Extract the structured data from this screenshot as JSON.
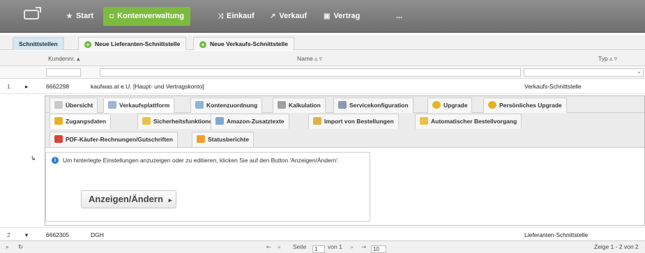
{
  "nav": {
    "items": [
      {
        "label": "Start",
        "icon": "star-icon"
      },
      {
        "label": "Kontenverwaltung",
        "icon": "accounts-icon"
      },
      {
        "label": "Einkauf",
        "icon": "shuffle-icon"
      },
      {
        "label": "Verkauf",
        "icon": "share-icon"
      },
      {
        "label": "Vertrag",
        "icon": "contract-icon"
      },
      {
        "label": "...",
        "icon": ""
      }
    ]
  },
  "tabs": {
    "interfaces": "Schnittstellen",
    "new_supplier": "Neue Lieferanten-Schnittstelle",
    "new_sales": "Neue Verkaufs-Schnittstelle"
  },
  "grid": {
    "columns": {
      "customer_no": "Kundennr. ▴",
      "name": "Name ▵ ▿",
      "type": "Typ ▵ ▿"
    },
    "rows": [
      {
        "index": "1",
        "toggle": "▸",
        "customer_no": "6662298",
        "name": "kaufwas.at e.U. [Haupt- und Vertragskonto]",
        "type": "Verkaufs-Schnittstelle"
      },
      {
        "index": "2",
        "toggle": "▾",
        "customer_no": "6662305",
        "name": "DGH",
        "type": "Lieferanten-Schnittstelle"
      }
    ],
    "sub_marker": "↳"
  },
  "panel": {
    "tabs1": [
      {
        "label": "Übersicht",
        "color": "#c9c9c9"
      },
      {
        "label": "Verkaufsplattform",
        "color": "#9bb5d4"
      },
      {
        "label": "Kontenzuordnung",
        "color": "#8fb3d9"
      },
      {
        "label": "Kalkulation",
        "color": "#a0a0a0"
      },
      {
        "label": "Servicekonfiguration",
        "color": "#8c9ab0"
      },
      {
        "label": "Upgrade",
        "color": "#e6b325"
      },
      {
        "label": "Persönliches Upgrade",
        "color": "#e6b325"
      }
    ],
    "tabs2": [
      {
        "label": "Zugangsdaten",
        "color": "#e6b325"
      },
      {
        "label": "Sicherheitsfunktionen",
        "color": "#e8c24a"
      },
      {
        "label": "Amazon-Zusatztexte",
        "color": "#7fa8d6"
      },
      {
        "label": "Import von Bestellungen",
        "color": "#d9b34a"
      },
      {
        "label": "Automatischer Bestellvorgang",
        "color": "#e8c24a"
      }
    ],
    "tabs3": [
      {
        "label": "PDF-Käufer-Rechnungen/Gutschriften",
        "color": "#d9453a"
      },
      {
        "label": "Statusberichte",
        "color": "#f0a030"
      }
    ],
    "info": "Um hinterlegte Einstellungen anzuzeigen oder zu editieren, klicken Sie auf den Button 'Anzeigen/Ändern'.",
    "button": "Anzeigen/Ändern"
  },
  "footer": {
    "first": "⇤",
    "prev": "«",
    "page_label": "Seite",
    "page_value": "1",
    "of_label": "von 1",
    "next": "»",
    "last": "⇥",
    "page_size": "10",
    "summary": "Zeige 1 - 2 von 2"
  },
  "colors": {
    "accent": "#7dbb3f",
    "selected_tab": "#d8e6f1",
    "info": "#2b7cd3"
  }
}
